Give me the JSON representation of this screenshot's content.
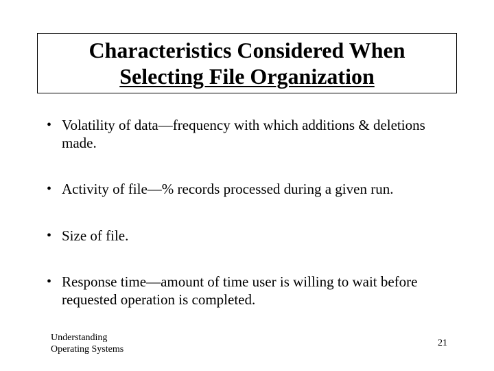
{
  "title": {
    "line1": "Characteristics Considered When",
    "line2": "Selecting File Organization"
  },
  "bullets": [
    "Volatility of data—frequency with which additions & deletions made.",
    "Activity of file—% records processed during a given run.",
    "Size of file.",
    "Response time—amount of time user is willing to wait before requested operation is completed."
  ],
  "footer": {
    "source_line1": "Understanding",
    "source_line2": "Operating Systems",
    "page_number": "21"
  }
}
